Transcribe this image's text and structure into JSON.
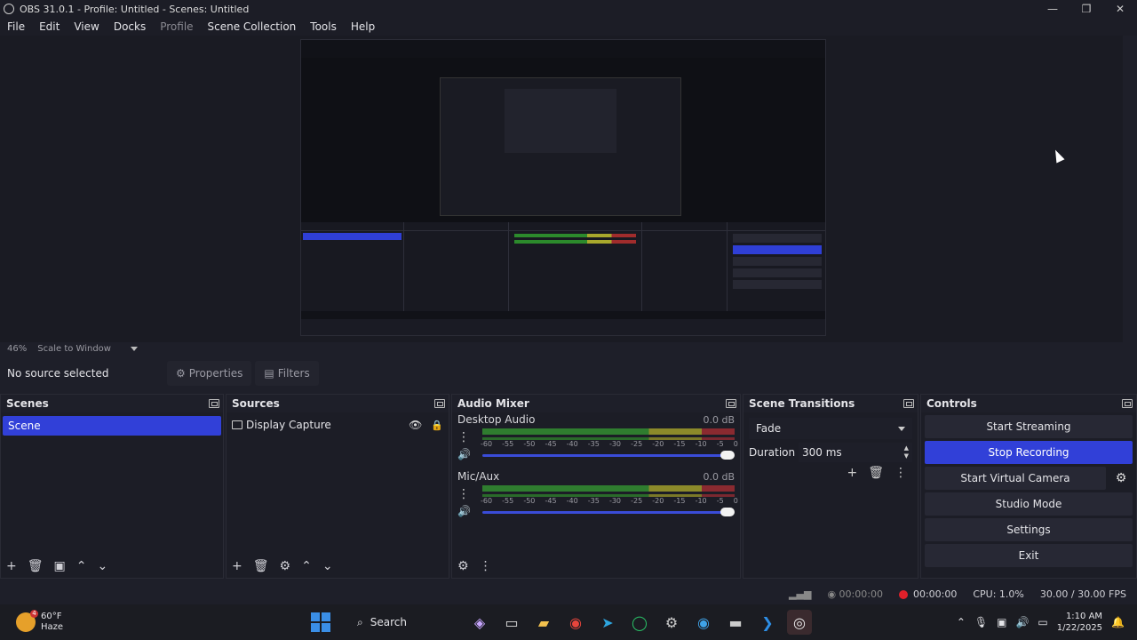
{
  "window": {
    "title": "OBS 31.0.1 - Profile: Untitled - Scenes: Untitled",
    "minimize": "—",
    "maximize": "❐",
    "close": "✕"
  },
  "menu": [
    "File",
    "Edit",
    "View",
    "Docks",
    "Profile",
    "Scene Collection",
    "Tools",
    "Help"
  ],
  "preview": {
    "zoom": "46%",
    "scale_mode": "Scale to Window"
  },
  "source_bar": {
    "no_source": "No source selected",
    "properties": "Properties",
    "filters": "Filters"
  },
  "scenes": {
    "title": "Scenes",
    "items": [
      "Scene"
    ]
  },
  "sources": {
    "title": "Sources",
    "items": [
      "Display Capture"
    ]
  },
  "mixer": {
    "title": "Audio Mixer",
    "channels": [
      {
        "name": "Desktop Audio",
        "db": "0.0 dB"
      },
      {
        "name": "Mic/Aux",
        "db": "0.0 dB"
      }
    ],
    "ticks": [
      "-60",
      "-55",
      "-50",
      "-45",
      "-40",
      "-35",
      "-30",
      "-25",
      "-20",
      "-15",
      "-10",
      "-5",
      "0"
    ]
  },
  "transitions": {
    "title": "Scene Transitions",
    "selected": "Fade",
    "duration_label": "Duration",
    "duration_value": "300 ms"
  },
  "controls": {
    "title": "Controls",
    "start_streaming": "Start Streaming",
    "stop_recording": "Stop Recording",
    "start_virtual_camera": "Start Virtual Camera",
    "studio_mode": "Studio Mode",
    "settings": "Settings",
    "exit": "Exit"
  },
  "status": {
    "stream_time": "00:00:00",
    "rec_time": "00:00:00",
    "cpu": "CPU: 1.0%",
    "fps": "30.00 / 30.00 FPS"
  },
  "taskbar": {
    "temperature": "60°F",
    "condition": "Haze",
    "weather_badge": "4",
    "search": "Search",
    "time": "1:10 AM",
    "date": "1/22/2025"
  },
  "colors": {
    "accent": "#3140d8",
    "record": "#e0202a",
    "bg": "#1e1f29"
  }
}
